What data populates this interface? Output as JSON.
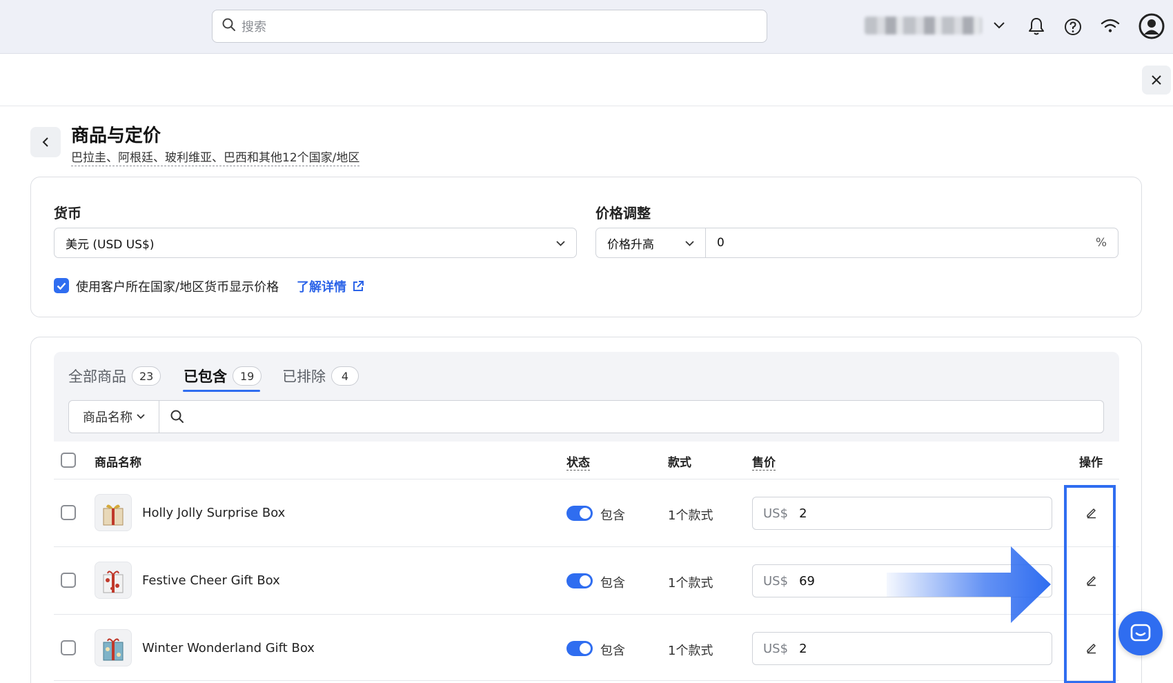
{
  "topbar": {
    "search_placeholder": "搜索",
    "icons": [
      "search-icon",
      "chevron-down-icon",
      "bell-icon",
      "help-icon",
      "wifi-icon",
      "user-avatar-icon"
    ]
  },
  "header": {
    "title": "商品与定价",
    "subtitle": "巴拉圭、阿根廷、玻利维亚、巴西和其他12个国家/地区"
  },
  "pricing": {
    "currency_label": "货币",
    "currency_value": "美元 (USD US$)",
    "adjust_label": "价格调整",
    "adjust_type": "价格升高",
    "adjust_value": "0",
    "adjust_unit": "%",
    "local_currency_checkbox": "使用客户所在国家/地区货币显示价格",
    "local_currency_checked": true,
    "learn_more": "了解详情"
  },
  "tabs": [
    {
      "label": "全部商品",
      "count": "23"
    },
    {
      "label": "已包含",
      "count": "19"
    },
    {
      "label": "已排除",
      "count": "4"
    }
  ],
  "filter": {
    "field": "商品名称"
  },
  "table": {
    "headers": {
      "name": "商品名称",
      "status": "状态",
      "variants": "款式",
      "price": "售价",
      "actions": "操作"
    },
    "rows": [
      {
        "name": "Holly Jolly Surprise Box",
        "status": "包含",
        "variants": "1个款式",
        "currency": "US$",
        "price": "2"
      },
      {
        "name": "Festive Cheer Gift Box",
        "status": "包含",
        "variants": "1个款式",
        "currency": "US$",
        "price": "69"
      },
      {
        "name": "Winter Wonderland Gift Box",
        "status": "包含",
        "variants": "1个款式",
        "currency": "US$",
        "price": "2"
      }
    ]
  },
  "colors": {
    "accent": "#2f6df0",
    "topbar_bg": "#eef0f7"
  }
}
